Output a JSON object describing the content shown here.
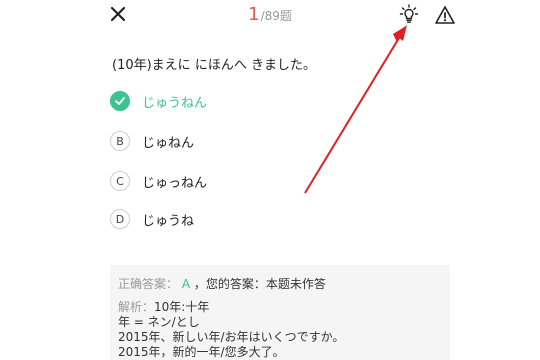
{
  "header": {
    "close_icon": "close-icon",
    "current": "1",
    "total": "/89题",
    "hint_icon": "lightbulb-icon",
    "report_icon": "warning-triangle-icon"
  },
  "question": {
    "text": "(10年)まえに にほんへ きました。"
  },
  "options": [
    {
      "marker": "",
      "text": "じゅうねん",
      "state": "correct"
    },
    {
      "marker": "B",
      "text": "じゅねん"
    },
    {
      "marker": "C",
      "text": "じゅっねん"
    },
    {
      "marker": "D",
      "text": "じゅうね"
    }
  ],
  "answer": {
    "label": "正确答案：",
    "value": "A",
    "yours": "，您的答案：本题未作答",
    "explanation_label": "解析：",
    "explanation_lines": [
      "10年:十年",
      "年 = ネン/とし",
      "2015年、新しい年/お年はいくつですか。",
      "2015年，新的一年/您多大了。"
    ]
  },
  "colors": {
    "accent_correct": "#3ec28f",
    "counter_current": "#e9584b",
    "annotation_arrow": "#e02020"
  }
}
